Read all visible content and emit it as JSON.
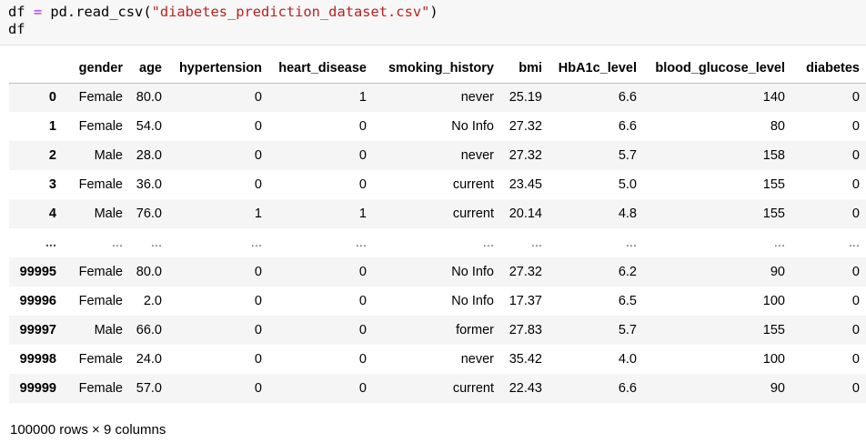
{
  "code": {
    "var": "df",
    "op": "=",
    "call_prefix": "pd.read_csv(",
    "arg": "\"diabetes_prediction_dataset.csv\"",
    "call_suffix": ")",
    "line2": "df"
  },
  "table": {
    "columns": [
      "",
      "gender",
      "age",
      "hypertension",
      "heart_disease",
      "smoking_history",
      "bmi",
      "HbA1c_level",
      "blood_glucose_level",
      "diabetes"
    ],
    "rows": [
      [
        "0",
        "Female",
        "80.0",
        "0",
        "1",
        "never",
        "25.19",
        "6.6",
        "140",
        "0"
      ],
      [
        "1",
        "Female",
        "54.0",
        "0",
        "0",
        "No Info",
        "27.32",
        "6.6",
        "80",
        "0"
      ],
      [
        "2",
        "Male",
        "28.0",
        "0",
        "0",
        "never",
        "27.32",
        "5.7",
        "158",
        "0"
      ],
      [
        "3",
        "Female",
        "36.0",
        "0",
        "0",
        "current",
        "23.45",
        "5.0",
        "155",
        "0"
      ],
      [
        "4",
        "Male",
        "76.0",
        "1",
        "1",
        "current",
        "20.14",
        "4.8",
        "155",
        "0"
      ],
      [
        "...",
        "...",
        "...",
        "...",
        "...",
        "...",
        "...",
        "...",
        "...",
        "..."
      ],
      [
        "99995",
        "Female",
        "80.0",
        "0",
        "0",
        "No Info",
        "27.32",
        "6.2",
        "90",
        "0"
      ],
      [
        "99996",
        "Female",
        "2.0",
        "0",
        "0",
        "No Info",
        "17.37",
        "6.5",
        "100",
        "0"
      ],
      [
        "99997",
        "Male",
        "66.0",
        "0",
        "0",
        "former",
        "27.83",
        "5.7",
        "155",
        "0"
      ],
      [
        "99998",
        "Female",
        "24.0",
        "0",
        "0",
        "never",
        "35.42",
        "4.0",
        "100",
        "0"
      ],
      [
        "99999",
        "Female",
        "57.0",
        "0",
        "0",
        "current",
        "22.43",
        "6.6",
        "90",
        "0"
      ]
    ]
  },
  "shape": "100000 rows × 9 columns"
}
